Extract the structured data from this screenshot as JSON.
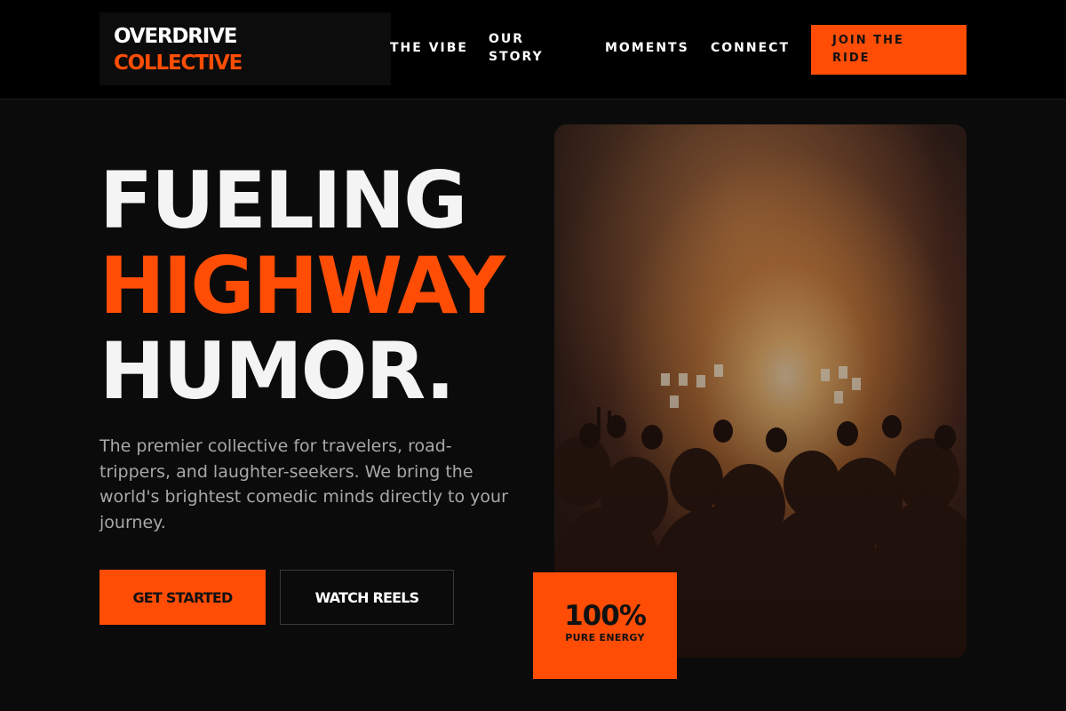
{
  "header": {
    "logo": {
      "line1": "OVERDRIVE",
      "line2": "COLLECTIVE"
    },
    "nav": [
      {
        "label": "THE VIBE"
      },
      {
        "label": "OUR STORY"
      },
      {
        "label": "MOMENTS"
      },
      {
        "label": "CONNECT"
      }
    ],
    "cta_label": "JOIN THE RIDE"
  },
  "hero": {
    "headline": [
      "FUELING",
      "HIGHWAY",
      "HUMOR."
    ],
    "description": "The premier collective for travelers, road-trippers, and laughter-seekers. We bring the world's brightest comedic minds directly to your journey.",
    "primary_button": "GET STARTED",
    "secondary_button": "WATCH REELS",
    "stat": {
      "value": "100%",
      "label": "PURE ENERGY"
    }
  },
  "colors": {
    "accent": "#ff4d06",
    "background": "#0b0b0b",
    "header_background": "#000000",
    "text_muted": "#a8a8a8"
  }
}
